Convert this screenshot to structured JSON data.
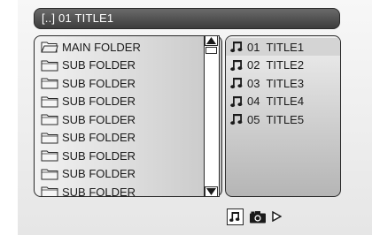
{
  "header": {
    "path_title": "[..] 01 TITLE1"
  },
  "folders": [
    {
      "label": "MAIN FOLDER",
      "icon": "open-folder-icon"
    },
    {
      "label": "SUB FOLDER",
      "icon": "folder-icon"
    },
    {
      "label": "SUB FOLDER",
      "icon": "folder-icon"
    },
    {
      "label": "SUB FOLDER",
      "icon": "folder-icon"
    },
    {
      "label": "SUB FOLDER",
      "icon": "folder-icon"
    },
    {
      "label": "SUB FOLDER",
      "icon": "folder-icon"
    },
    {
      "label": "SUB FOLDER",
      "icon": "folder-icon"
    },
    {
      "label": "SUB FOLDER",
      "icon": "folder-icon"
    },
    {
      "label": "SUB FOLDER",
      "icon": "folder-icon"
    }
  ],
  "tracks": [
    {
      "label": "01  TITLE1",
      "icon": "music-note-icon",
      "selected": true
    },
    {
      "label": "02  TITLE2",
      "icon": "music-note-icon",
      "selected": false
    },
    {
      "label": "03  TITLE3",
      "icon": "music-note-icon",
      "selected": false
    },
    {
      "label": "04  TITLE4",
      "icon": "music-note-icon",
      "selected": false
    },
    {
      "label": "05  TITLE5",
      "icon": "music-note-icon",
      "selected": false
    }
  ],
  "modes": [
    {
      "icon": "music-mode-icon",
      "active": true
    },
    {
      "icon": "camera-mode-icon",
      "active": false
    },
    {
      "icon": "play-mode-icon",
      "active": false
    }
  ]
}
